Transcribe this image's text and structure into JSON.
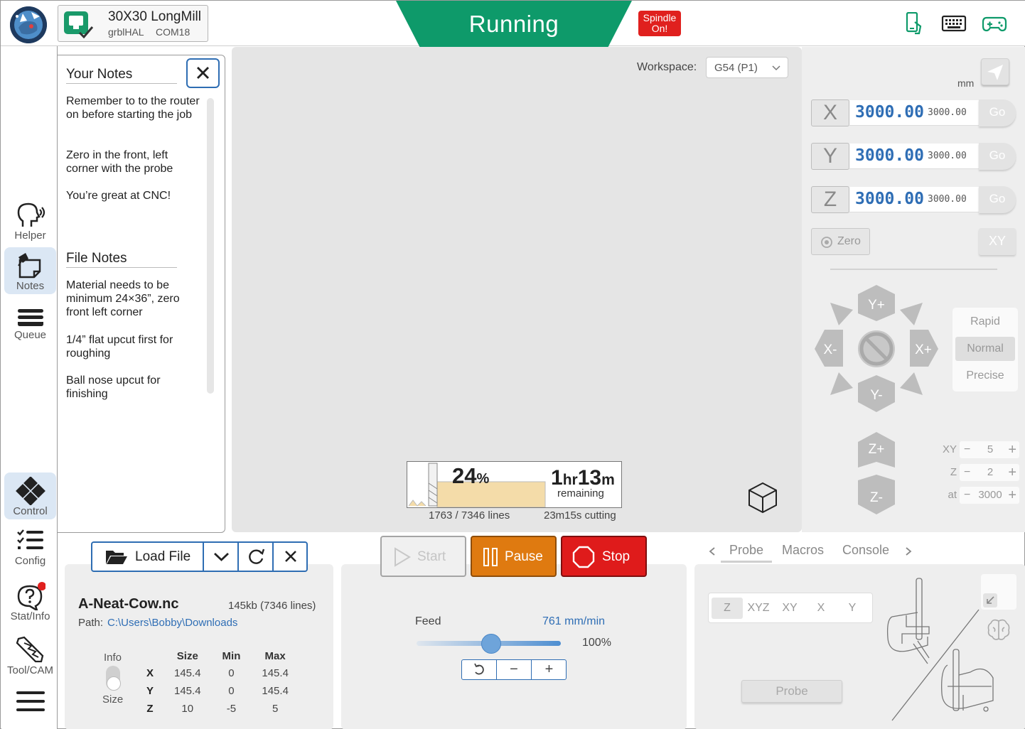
{
  "header": {
    "machine_name": "30X30 LongMill",
    "firmware": "grblHAL",
    "port": "COM18",
    "status": "Running",
    "spindle_badge": "Spindle On!",
    "colors": {
      "status_bg": "#0e9a6a",
      "spindle": "#e0201e",
      "accent": "#2e6db3"
    }
  },
  "sidebar": {
    "items": [
      {
        "label": "Helper",
        "icon": "helper-head-icon"
      },
      {
        "label": "Notes",
        "icon": "notes-pin-icon"
      },
      {
        "label": "Queue",
        "icon": "queue-stack-icon"
      },
      {
        "label": "Control",
        "icon": "control-diamond-icon"
      },
      {
        "label": "Config",
        "icon": "config-list-icon"
      },
      {
        "label": "Stat/Info",
        "icon": "stat-info-question-icon"
      },
      {
        "label": "Tool/CAM",
        "icon": "tool-endmill-icon"
      }
    ]
  },
  "notes": {
    "your_notes_title": "Your Notes",
    "your_notes": [
      "Remember to to the router on before starting the job",
      "Zero in the front, left corner with the probe",
      "You’re great at CNC!"
    ],
    "file_notes_title": "File Notes",
    "file_notes": [
      "Material needs to be minimum 24×36”, zero front left corner",
      "1/4” flat upcut first for roughing",
      "Ball nose upcut for finishing"
    ]
  },
  "visualizer": {
    "workspace_label": "Workspace:",
    "workspace_value": "G54 (P1)",
    "progress_percent": 24,
    "remaining_hr": "1",
    "remaining_min": "13",
    "remaining_hr_unit": "hr",
    "remaining_min_unit": "m",
    "remaining_label": "remaining",
    "lines": "1763 / 7346 lines",
    "cutting": "23m15s cutting"
  },
  "dro": {
    "units": "mm",
    "axes": [
      {
        "axis": "X",
        "value": "3000.00",
        "machine": "3000.00",
        "go": "Go"
      },
      {
        "axis": "Y",
        "value": "3000.00",
        "machine": "3000.00",
        "go": "Go"
      },
      {
        "axis": "Z",
        "value": "3000.00",
        "machine": "3000.00",
        "go": "Go"
      }
    ],
    "zero_label": "Zero",
    "xy_label": "XY"
  },
  "jog": {
    "y_plus": "Y+",
    "y_minus": "Y-",
    "x_plus": "X+",
    "x_minus": "X-",
    "z_plus": "Z+",
    "z_minus": "Z-",
    "speeds": [
      "Rapid",
      "Normal",
      "Precise"
    ],
    "selected_speed": "Normal",
    "steps": [
      {
        "label": "XY",
        "value": "5"
      },
      {
        "label": "Z",
        "value": "2"
      },
      {
        "label": "at",
        "value": "3000"
      }
    ]
  },
  "file": {
    "load_label": "Load File",
    "name": "A-Neat-Cow.nc",
    "size": "145kb (7346 lines)",
    "path_label": "Path:",
    "path": "C:\\Users\\Bobby\\Downloads",
    "info_label": "Info",
    "size_label": "Size",
    "dim_headers": [
      "Size",
      "Min",
      "Max"
    ],
    "dims": [
      {
        "axis": "X",
        "size": "145.4",
        "min": "0",
        "max": "145.4"
      },
      {
        "axis": "Y",
        "size": "145.4",
        "min": "0",
        "max": "145.4"
      },
      {
        "axis": "Z",
        "size": "10",
        "min": "-5",
        "max": "5"
      }
    ]
  },
  "run": {
    "start": "Start",
    "pause": "Pause",
    "stop": "Stop",
    "feed_label": "Feed",
    "feed_value": "761 mm/min",
    "feed_percent": "100%",
    "feed_slider_fraction": 0.5
  },
  "probe": {
    "tabs": [
      "Probe",
      "Macros",
      "Console"
    ],
    "active_tab": "Probe",
    "axes_options": [
      "Z",
      "XYZ",
      "XY",
      "X",
      "Y"
    ],
    "selected_axis": "Z",
    "probe_button": "Probe"
  }
}
